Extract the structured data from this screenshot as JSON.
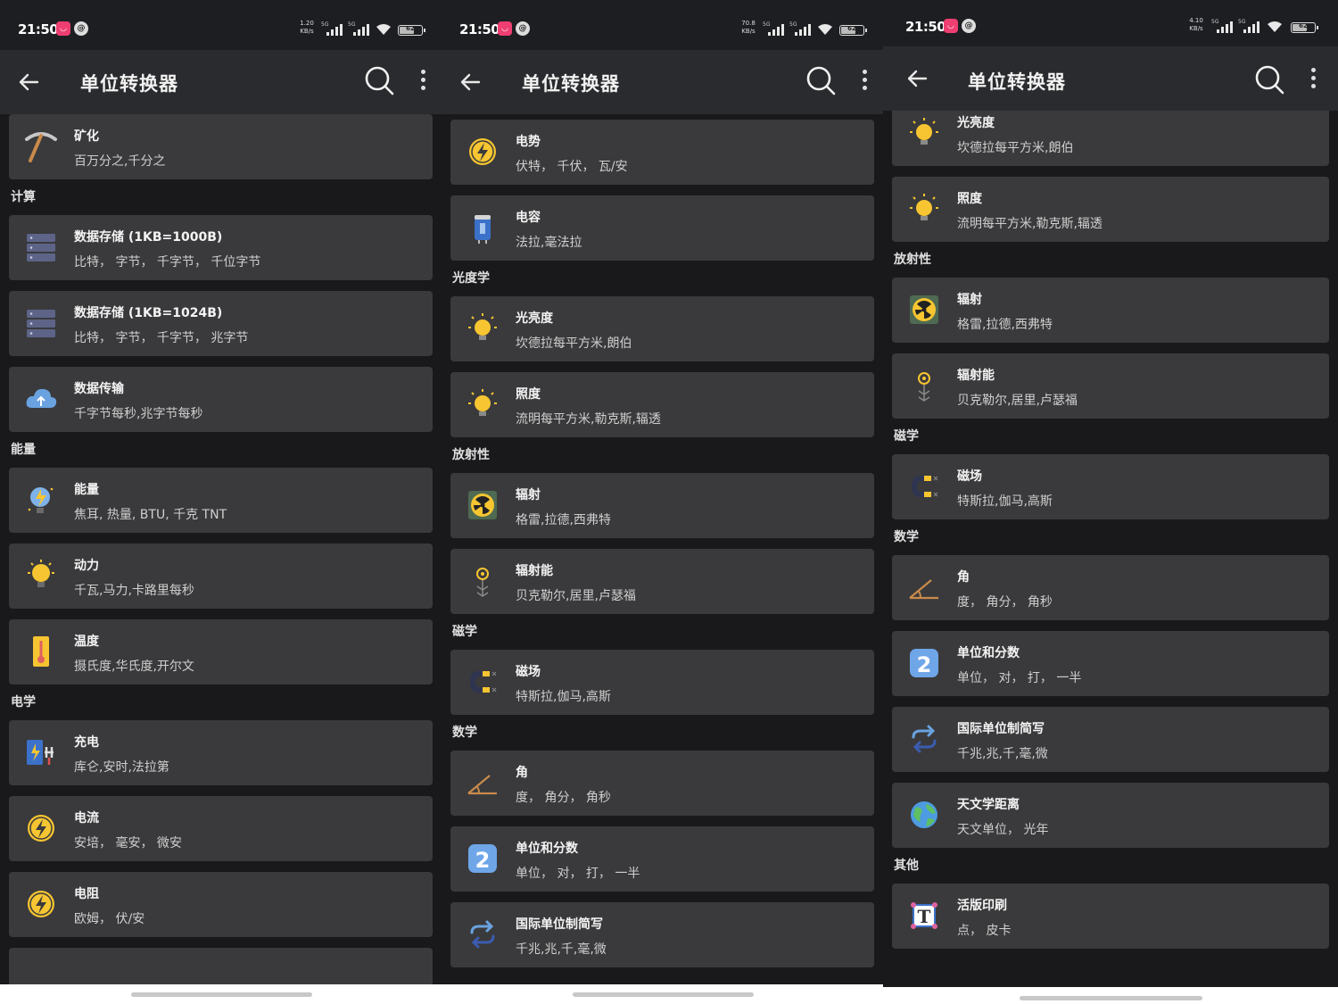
{
  "status": {
    "time": "21:50",
    "notif_icons": [
      "app-notification-icon",
      "at-sign-icon"
    ],
    "speeds": [
      {
        "value": "1.20",
        "unit": "KB/s"
      },
      {
        "value": "70.8",
        "unit": "KB/s"
      },
      {
        "value": "4.10",
        "unit": "KB/s"
      }
    ],
    "network": "5G",
    "battery": "62"
  },
  "appbar": {
    "title": "单位转换器",
    "back_icon": "arrow-left-icon",
    "search_icon": "search-icon",
    "more_icon": "more-vert-icon"
  },
  "screens": [
    {
      "items": [
        {
          "kind": "card",
          "icon": "pickaxe-icon",
          "title": "矿化",
          "subtitle": "百万分之,千分之"
        },
        {
          "kind": "header",
          "label": "计算"
        },
        {
          "kind": "card",
          "icon": "server-icon",
          "title": "数据存储 (1KB=1000B)",
          "subtitle": "比特， 字节， 千字节， 千位字节"
        },
        {
          "kind": "card",
          "icon": "server-icon",
          "title": "数据存储 (1KB=1024B)",
          "subtitle": "比特， 字节， 千字节， 兆字节"
        },
        {
          "kind": "card",
          "icon": "cloud-upload-icon",
          "title": "数据传输",
          "subtitle": "千字节每秒,兆字节每秒"
        },
        {
          "kind": "header",
          "label": "能量"
        },
        {
          "kind": "card",
          "icon": "energy-bulb-icon",
          "title": "能量",
          "subtitle": "焦耳, 热量, BTU, 千克 TNT"
        },
        {
          "kind": "card",
          "icon": "lightbulb-icon",
          "title": "动力",
          "subtitle": "千瓦,马力,卡路里每秒"
        },
        {
          "kind": "card",
          "icon": "thermometer-icon",
          "title": "温度",
          "subtitle": "摄氏度,华氏度,开尔文"
        },
        {
          "kind": "header",
          "label": "电学"
        },
        {
          "kind": "card",
          "icon": "charging-icon",
          "title": "充电",
          "subtitle": "库仑,安时,法拉第"
        },
        {
          "kind": "card",
          "icon": "lightning-icon",
          "title": "电流",
          "subtitle": "安培， 毫安， 微安"
        },
        {
          "kind": "card",
          "icon": "lightning-icon",
          "title": "电阻",
          "subtitle": "欧姆， 伏/安"
        },
        {
          "kind": "card",
          "icon": "",
          "title": "",
          "subtitle": ""
        }
      ]
    },
    {
      "items": [
        {
          "kind": "card",
          "icon": "lightning-icon",
          "title": "电势",
          "subtitle": "伏特， 千伏， 瓦/安"
        },
        {
          "kind": "card",
          "icon": "capacitor-icon",
          "title": "电容",
          "subtitle": "法拉,毫法拉"
        },
        {
          "kind": "header",
          "label": "光度学"
        },
        {
          "kind": "card",
          "icon": "sun-bulb-icon",
          "title": "光亮度",
          "subtitle": "坎德拉每平方米,朗伯"
        },
        {
          "kind": "card",
          "icon": "sun-bulb-icon",
          "title": "照度",
          "subtitle": "流明每平方米,勒克斯,辐透"
        },
        {
          "kind": "header",
          "label": "放射性"
        },
        {
          "kind": "card",
          "icon": "radiation-icon",
          "title": "辐射",
          "subtitle": "格雷,拉德,西弗特"
        },
        {
          "kind": "card",
          "icon": "radiation-energy-icon",
          "title": "辐射能",
          "subtitle": "贝克勒尔,居里,卢瑟福"
        },
        {
          "kind": "header",
          "label": "磁学"
        },
        {
          "kind": "card",
          "icon": "magnet-icon",
          "title": "磁场",
          "subtitle": "特斯拉,伽马,高斯"
        },
        {
          "kind": "header",
          "label": "数学"
        },
        {
          "kind": "card",
          "icon": "angle-icon",
          "title": "角",
          "subtitle": "度， 角分， 角秒"
        },
        {
          "kind": "card",
          "icon": "number-two-icon",
          "title": "单位和分数",
          "subtitle": "单位， 对， 打， 一半"
        },
        {
          "kind": "card",
          "icon": "repeat-icon",
          "title": "国际单位制简写",
          "subtitle": "千兆,兆,千,毫,微"
        }
      ]
    },
    {
      "items": [
        {
          "kind": "card",
          "icon": "sun-bulb-icon",
          "title": "光亮度",
          "subtitle": "坎德拉每平方米,朗伯"
        },
        {
          "kind": "card",
          "icon": "sun-bulb-icon",
          "title": "照度",
          "subtitle": "流明每平方米,勒克斯,辐透"
        },
        {
          "kind": "header",
          "label": "放射性"
        },
        {
          "kind": "card",
          "icon": "radiation-icon",
          "title": "辐射",
          "subtitle": "格雷,拉德,西弗特"
        },
        {
          "kind": "card",
          "icon": "radiation-energy-icon",
          "title": "辐射能",
          "subtitle": "贝克勒尔,居里,卢瑟福"
        },
        {
          "kind": "header",
          "label": "磁学"
        },
        {
          "kind": "card",
          "icon": "magnet-icon",
          "title": "磁场",
          "subtitle": "特斯拉,伽马,高斯"
        },
        {
          "kind": "header",
          "label": "数学"
        },
        {
          "kind": "card",
          "icon": "angle-icon",
          "title": "角",
          "subtitle": "度， 角分， 角秒"
        },
        {
          "kind": "card",
          "icon": "number-two-icon",
          "title": "单位和分数",
          "subtitle": "单位， 对， 打， 一半"
        },
        {
          "kind": "card",
          "icon": "repeat-icon",
          "title": "国际单位制简写",
          "subtitle": "千兆,兆,千,毫,微"
        },
        {
          "kind": "card",
          "icon": "globe-icon",
          "title": "天文学距离",
          "subtitle": "天文单位， 光年"
        },
        {
          "kind": "header",
          "label": "其他"
        },
        {
          "kind": "card",
          "icon": "typography-icon",
          "title": "活版印刷",
          "subtitle": "点， 皮卡"
        }
      ]
    }
  ]
}
